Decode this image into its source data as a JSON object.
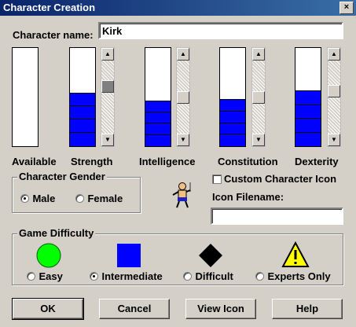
{
  "window": {
    "title": "Character Creation",
    "close_label": "×"
  },
  "name": {
    "label": "Character name:",
    "value": "Kirk"
  },
  "attributes": [
    {
      "label": "Available",
      "fill": 0.0,
      "scroll": null
    },
    {
      "label": "Strength",
      "fill": 0.54,
      "scroll": 0.35
    },
    {
      "label": "Intelligence",
      "fill": 0.46,
      "scroll": 0.62
    },
    {
      "label": "Constitution",
      "fill": 0.47,
      "scroll": 0.62
    },
    {
      "label": "Dexterity",
      "fill": 0.56,
      "scroll": 0.52
    }
  ],
  "gender": {
    "title": "Character Gender",
    "options": [
      {
        "label": "Male",
        "selected": true
      },
      {
        "label": "Female",
        "selected": false
      }
    ]
  },
  "custom_icon": {
    "label": "Custom Character Icon",
    "checked": false,
    "filename_label": "Icon Filename:",
    "filename_value": ""
  },
  "difficulty": {
    "title": "Game Difficulty",
    "options": [
      {
        "label": "Easy",
        "selected": false,
        "icon": "green-circle-icon",
        "color": "#00ff00"
      },
      {
        "label": "Intermediate",
        "selected": true,
        "icon": "blue-square-icon",
        "color": "#0000ff"
      },
      {
        "label": "Difficult",
        "selected": false,
        "icon": "black-diamond-icon",
        "color": "#000000"
      },
      {
        "label": "Experts Only",
        "selected": false,
        "icon": "warning-triangle-icon",
        "color": "#ffff00"
      }
    ]
  },
  "buttons": {
    "ok": "OK",
    "cancel": "Cancel",
    "view_icon": "View Icon",
    "help": "Help"
  }
}
